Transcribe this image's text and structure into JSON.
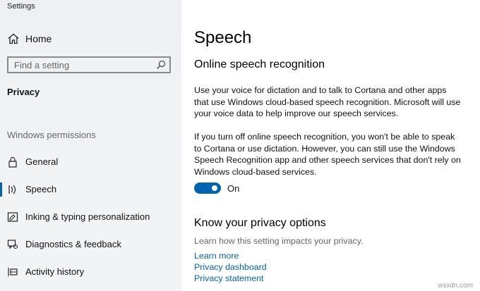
{
  "window": {
    "title": "Settings"
  },
  "sidebar": {
    "home_label": "Home",
    "search_placeholder": "Find a setting",
    "section_title": "Privacy",
    "group_label": "Windows permissions",
    "items": [
      {
        "label": "General",
        "icon": "lock-icon",
        "selected": false
      },
      {
        "label": "Speech",
        "icon": "speech-icon",
        "selected": true
      },
      {
        "label": "Inking & typing personalization",
        "icon": "inking-icon",
        "selected": false
      },
      {
        "label": "Diagnostics & feedback",
        "icon": "diagnostics-icon",
        "selected": false
      },
      {
        "label": "Activity history",
        "icon": "activity-history-icon",
        "selected": false
      }
    ]
  },
  "main": {
    "title": "Speech",
    "section1_title": "Online speech recognition",
    "para1": "Use your voice for dictation and to talk to Cortana and other apps that use Windows cloud-based speech recognition. Microsoft will use your voice data to help improve our speech services.",
    "para2": "If you turn off online speech recognition, you won't be able to speak to Cortana or use dictation. However, you can still use the Windows Speech Recognition app and other speech services that don't rely on Windows cloud-based services.",
    "toggle_state": "On",
    "section2_title": "Know your privacy options",
    "section2_sub": "Learn how this setting impacts your privacy.",
    "links": [
      "Learn more",
      "Privacy dashboard",
      "Privacy statement"
    ]
  },
  "watermark": "wsxdn.com",
  "colors": {
    "accent": "#0063b1",
    "sidebar_bg": "#f0f2f4"
  }
}
